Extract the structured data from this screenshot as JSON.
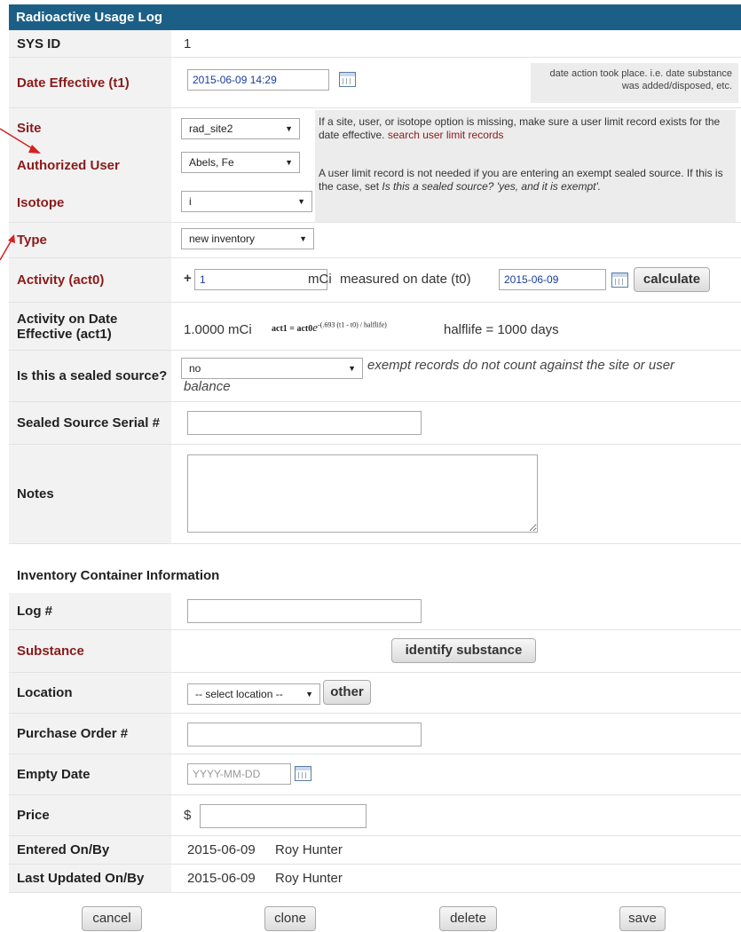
{
  "title": "Radioactive Usage Log",
  "fields": {
    "sys_id": {
      "label": "SYS ID",
      "value": "1"
    },
    "date_effective": {
      "label": "Date Effective (t1)",
      "value": "2015-06-09 14:29",
      "note": "date action took place. i.e. date substance was added/disposed, etc."
    },
    "site": {
      "label": "Site",
      "value": "rad_site2"
    },
    "authorized_user": {
      "label": "Authorized User",
      "value": "Abels, Fe"
    },
    "isotope": {
      "label": "Isotope",
      "value": "i"
    },
    "type": {
      "label": "Type",
      "value": "new inventory"
    },
    "activity": {
      "label": "Activity (act0)",
      "sign": "+",
      "value": "1",
      "unit": "mCi",
      "measured_label": "measured on date (t0)",
      "measured_date": "2015-06-09",
      "calculate": "calculate"
    },
    "activity_effective": {
      "label": "Activity on Date Effective (act1)",
      "value": "1.0000 mCi",
      "formula_lhs": "act1 = act0",
      "formula_e": "e",
      "formula_exp": "-(.693 (t1 - t0) / halflife)",
      "halflife": "halflife = 1000 days"
    },
    "sealed": {
      "label": "Is this a sealed source?",
      "value": "no",
      "note_a": "exempt records do not count against the site or user",
      "note_b": "balance"
    },
    "serial": {
      "label": "Sealed Source Serial #",
      "value": ""
    },
    "notes": {
      "label": "Notes",
      "value": ""
    }
  },
  "help_note": {
    "line1": "If a site, user, or isotope option is missing, make sure a user limit record exists for the date effective.",
    "link": "search user limit records",
    "line2_a": "A user limit record is not needed if you are entering an exempt sealed source. If this is the case, set",
    "line2_em": "Is this a sealed source? 'yes, and it is exempt'."
  },
  "inventory": {
    "heading": "Inventory Container Information",
    "log": {
      "label": "Log #",
      "value": ""
    },
    "substance": {
      "label": "Substance",
      "button": "identify substance"
    },
    "location": {
      "label": "Location",
      "value": "-- select location --",
      "other": "other"
    },
    "po": {
      "label": "Purchase Order #",
      "value": ""
    },
    "empty_date": {
      "label": "Empty Date",
      "placeholder": "YYYY-MM-DD"
    },
    "price": {
      "label": "Price",
      "currency": "$",
      "value": ""
    },
    "entered": {
      "label": "Entered On/By",
      "date": "2015-06-09",
      "by": "Roy Hunter"
    },
    "updated": {
      "label": "Last Updated On/By",
      "date": "2015-06-09",
      "by": "Roy Hunter"
    }
  },
  "buttons": {
    "cancel": "cancel",
    "clone": "clone",
    "delete": "delete",
    "save": "save"
  },
  "colors": {
    "header": "#1c5f86",
    "required_label": "#8b1a1a",
    "arrow": "#d62020"
  }
}
